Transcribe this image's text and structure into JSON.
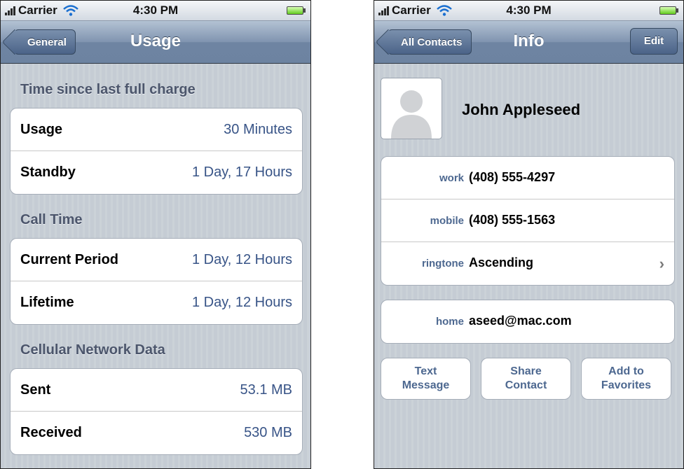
{
  "status_bar": {
    "carrier": "Carrier",
    "time": "4:30 PM"
  },
  "usage_screen": {
    "title": "Usage",
    "back_label": "General",
    "sections": [
      {
        "header": "Time since last full charge",
        "rows": [
          {
            "label": "Usage",
            "value": "30 Minutes"
          },
          {
            "label": "Standby",
            "value": "1 Day, 17 Hours"
          }
        ]
      },
      {
        "header": "Call Time",
        "rows": [
          {
            "label": "Current Period",
            "value": "1 Day, 12 Hours"
          },
          {
            "label": "Lifetime",
            "value": "1 Day, 12 Hours"
          }
        ]
      },
      {
        "header": "Cellular Network Data",
        "rows": [
          {
            "label": "Sent",
            "value": "53.1 MB"
          },
          {
            "label": "Received",
            "value": "530 MB"
          }
        ]
      }
    ]
  },
  "info_screen": {
    "title": "Info",
    "back_label": "All Contacts",
    "edit_label": "Edit",
    "contact_name": "John Appleseed",
    "phone_rows": [
      {
        "label": "work",
        "value": "(408) 555-4297"
      },
      {
        "label": "mobile",
        "value": "(408) 555-1563"
      },
      {
        "label": "ringtone",
        "value": "Ascending"
      }
    ],
    "email_row": {
      "label": "home",
      "value": "aseed@mac.com"
    },
    "actions": {
      "text_message": [
        "Text",
        "Message"
      ],
      "share_contact": [
        "Share",
        "Contact"
      ],
      "add_favorites": [
        "Add to",
        "Favorites"
      ]
    }
  },
  "colors": {
    "navbar": "#6e84a2",
    "background_stripes": "#c5ccd4",
    "value_blue": "#385487",
    "label_blue": "#4d6890",
    "section_header": "#4c566c"
  },
  "icons": [
    "signal-bars-icon",
    "wifi-icon",
    "battery-icon",
    "person-silhouette-icon",
    "chevron-right-icon"
  ]
}
